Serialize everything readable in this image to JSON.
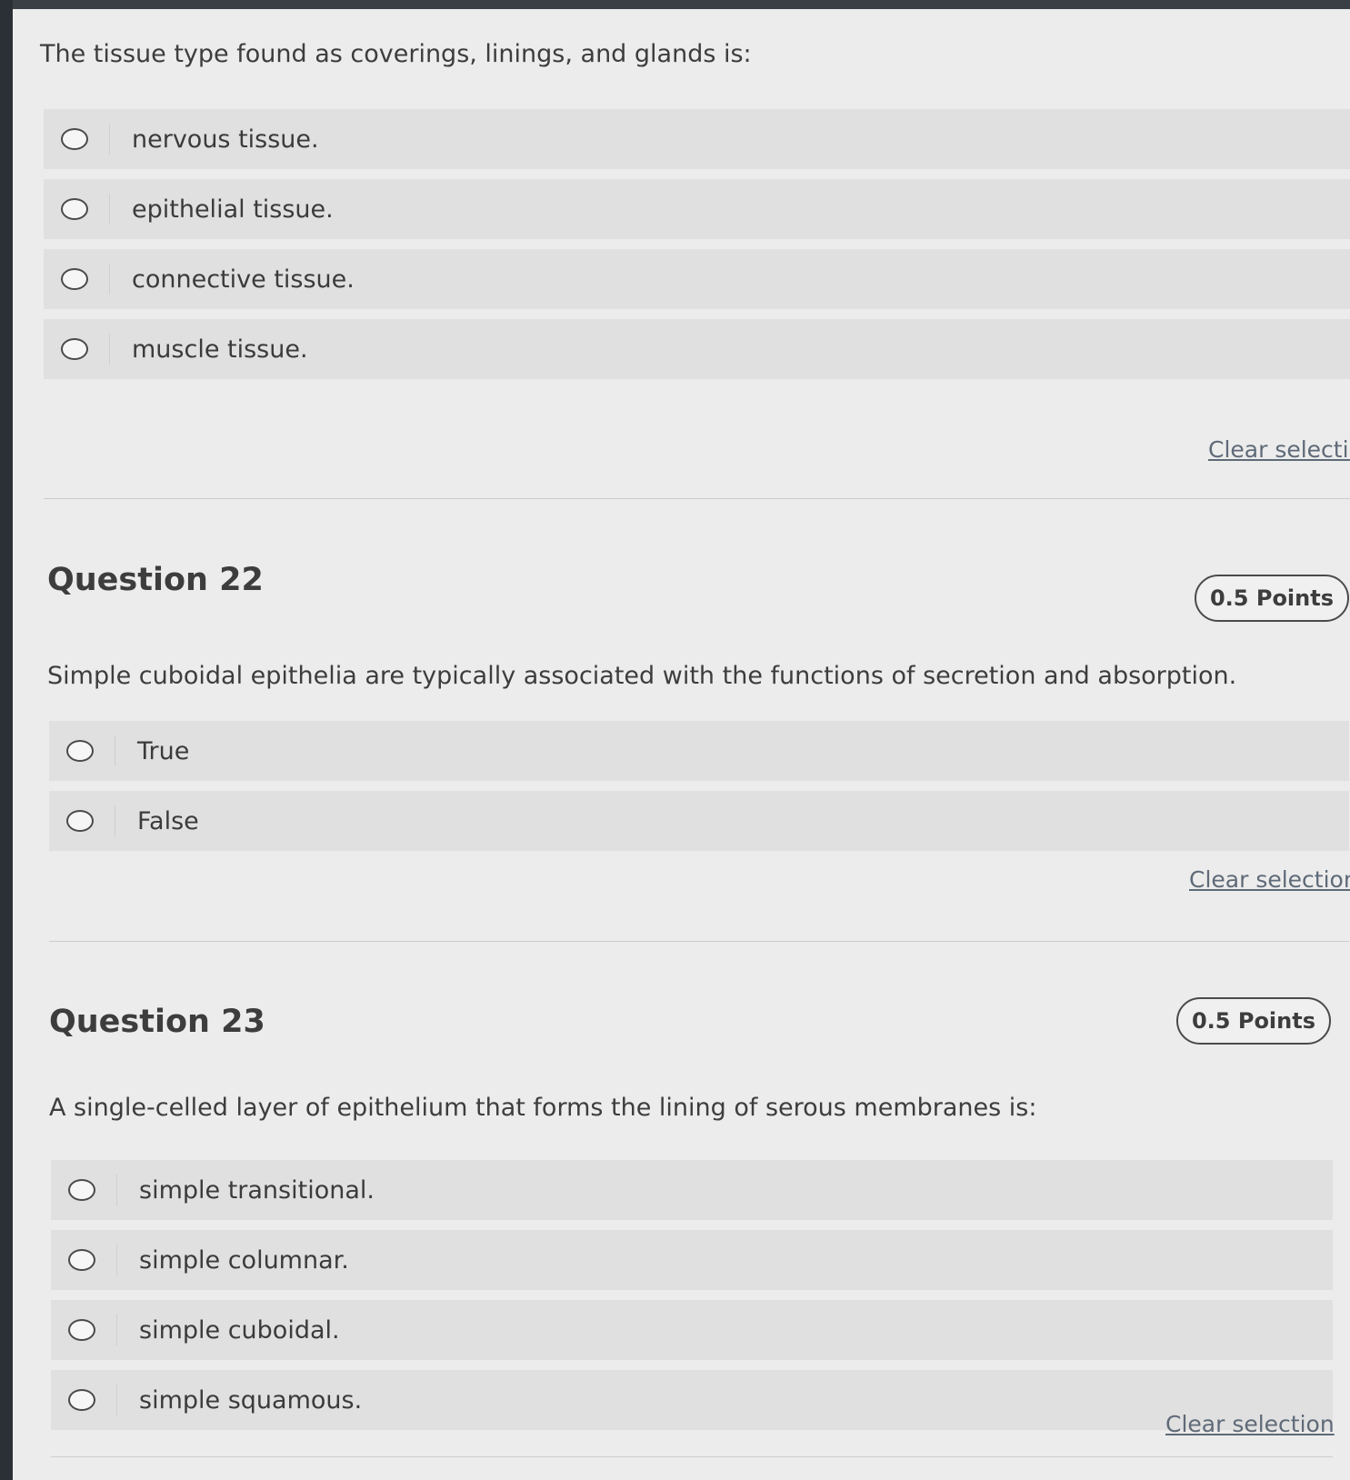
{
  "questions": [
    {
      "prompt": "The tissue type found as coverings, linings, and glands is:",
      "options": [
        "nervous tissue.",
        "epithelial tissue.",
        "connective tissue.",
        "muscle tissue."
      ],
      "clear_label": "Clear selectio"
    },
    {
      "title": "Question 22",
      "points": "0.5 Points",
      "prompt": "Simple cuboidal epithelia are typically associated with the functions of secretion and absorption.",
      "options": [
        "True",
        "False"
      ],
      "clear_label": "Clear selection"
    },
    {
      "title": "Question 23",
      "points": "0.5 Points",
      "prompt": "A single-celled layer of epithelium that forms the lining of serous membranes is:",
      "options": [
        "simple transitional.",
        "simple columnar.",
        "simple cuboidal.",
        "simple squamous."
      ],
      "clear_label": "Clear selection"
    }
  ]
}
